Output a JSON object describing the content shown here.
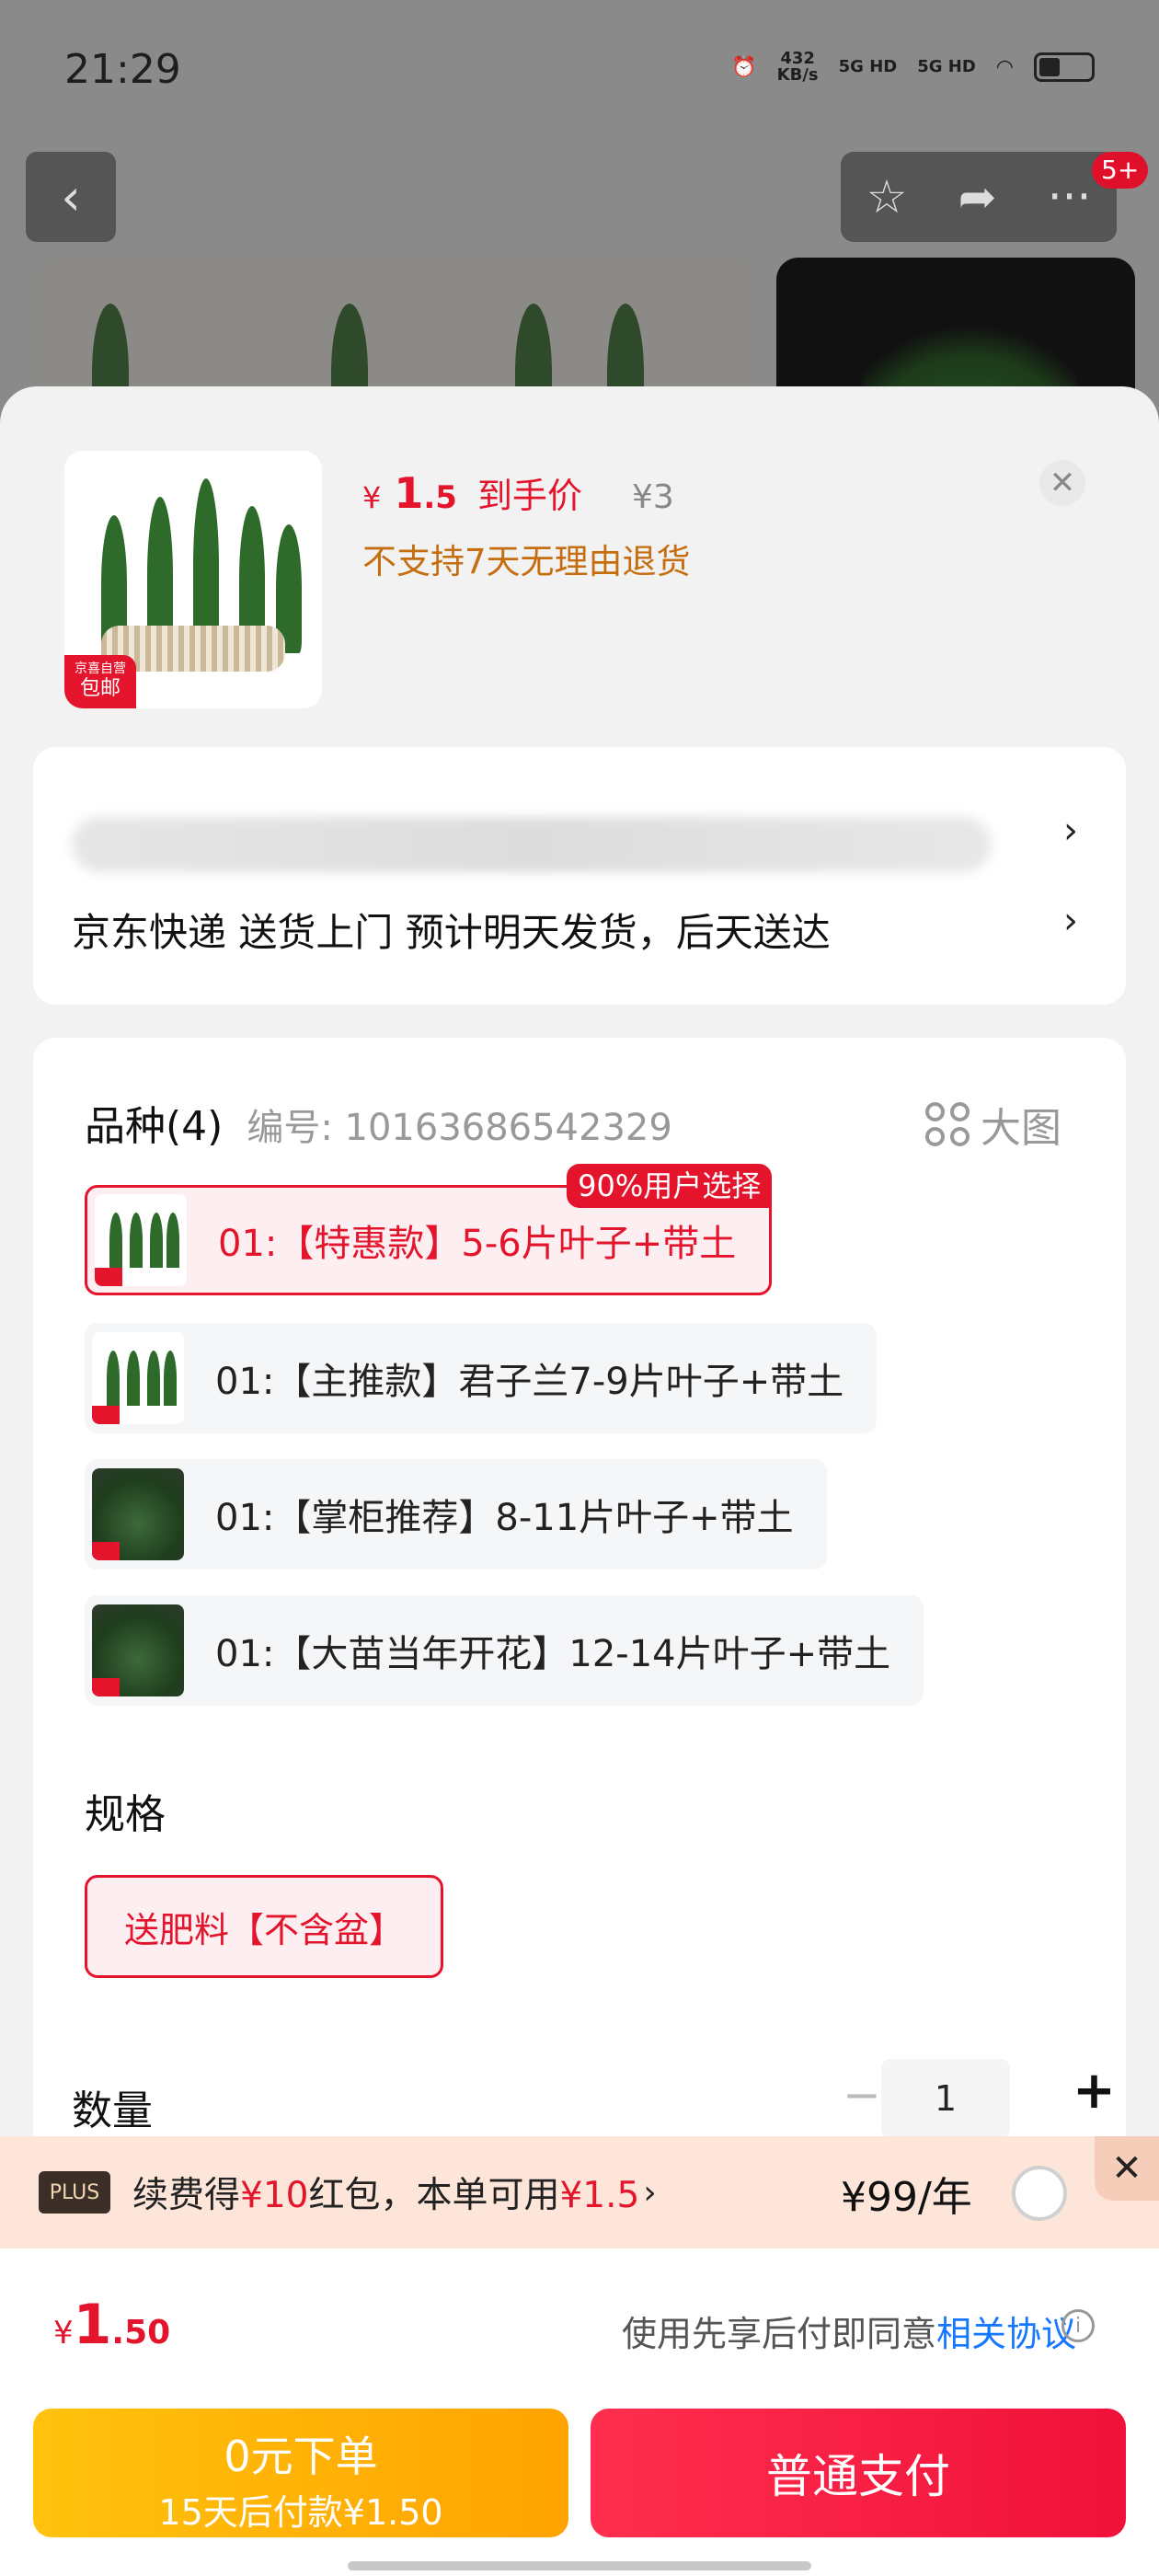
{
  "status_bar": {
    "time": "21:29",
    "net_speed_value": "432",
    "net_speed_unit": "KB/s",
    "sim1": "5G HD",
    "sim2": "5G HD"
  },
  "top_bar": {
    "badge": "5+"
  },
  "product": {
    "price_symbol": "¥",
    "price_integer": "1",
    "price_decimal": ".5",
    "price_label": "到手价",
    "original_price": "¥3",
    "return_policy": "不支持7天无理由退货",
    "thumb_tag_line1": "京喜自营",
    "thumb_tag_line2": "包邮"
  },
  "delivery": {
    "shipping_text": "京东快递 送货上门 预计明天发货，后天送达"
  },
  "variety": {
    "title": "品种(4)",
    "code": "编号: 10163686542329",
    "big_view_label": "大图",
    "options": [
      {
        "label": "01:【特惠款】5-6片叶子+带土",
        "badge": "90%用户选择",
        "selected": true
      },
      {
        "label": "01:【主推款】君子兰7-9片叶子+带土",
        "selected": false
      },
      {
        "label": "01:【掌柜推荐】8-11片叶子+带土",
        "selected": false
      },
      {
        "label": "01:【大苗当年开花】12-14片叶子+带土",
        "selected": false
      }
    ]
  },
  "spec": {
    "title": "规格",
    "option": "送肥料【不含盆】"
  },
  "quantity": {
    "title": "数量",
    "value": "1"
  },
  "plus": {
    "logo": "PLUS",
    "text_1": "续费得",
    "text_amount": "¥10",
    "text_2": "红包，本单可用",
    "text_usable": "¥1.5",
    "price": "¥99/年"
  },
  "checkout": {
    "total_symbol": "¥",
    "total_integer": "1",
    "total_decimal": ".50",
    "agreement_text": "使用先享后付即同意",
    "agreement_link": "相关协议",
    "pay_later_line1": "0元下单",
    "pay_later_line2": "15天后付款¥1.50",
    "pay_normal": "普通支付"
  }
}
